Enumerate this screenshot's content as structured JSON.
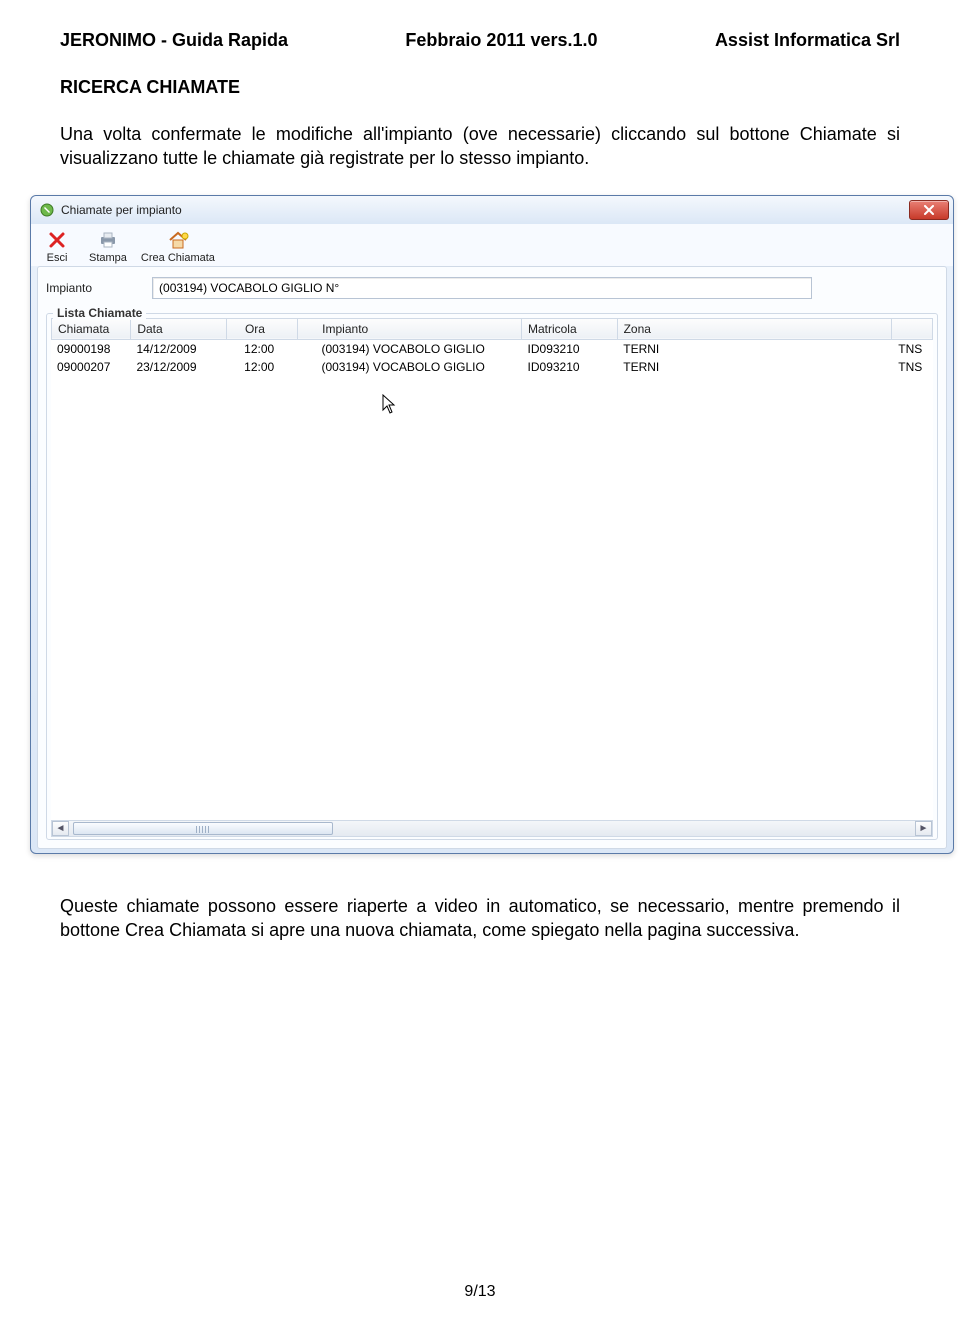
{
  "header": {
    "left": "JERONIMO - Guida Rapida",
    "center": "Febbraio 2011 vers.1.0",
    "right": "Assist Informatica Srl"
  },
  "section_title": "RICERCA CHIAMATE",
  "intro_para": "Una volta confermate le modifiche all'impianto (ove necessarie) cliccando sul bottone Chiamate si visualizzano tutte le chiamate già registrate per lo stesso impianto.",
  "window": {
    "title": "Chiamate per impianto",
    "toolbar": {
      "esci": "Esci",
      "stampa": "Stampa",
      "crea": "Crea Chiamata"
    },
    "field": {
      "label": "Impianto",
      "value": "(003194) VOCABOLO GIGLIO N°"
    },
    "fieldset_legend": "Lista Chiamate",
    "columns": {
      "chiamata": "Chiamata",
      "data": "Data",
      "ora": "Ora",
      "impianto": "Impianto",
      "matricola": "Matricola",
      "zona": "Zona"
    },
    "rows": [
      {
        "chiamata": "09000198",
        "data": "14/12/2009",
        "ora": "12:00",
        "impianto": "(003194) VOCABOLO GIGLIO",
        "matricola": "ID093210",
        "zona": "TERNI",
        "last": "TNS"
      },
      {
        "chiamata": "09000207",
        "data": "23/12/2009",
        "ora": "12:00",
        "impianto": "(003194) VOCABOLO GIGLIO",
        "matricola": "ID093210",
        "zona": "TERNI",
        "last": "TNS"
      }
    ]
  },
  "footer_para": "Queste chiamate possono essere riaperte a video in automatico, se necessario, mentre premendo il bottone Crea Chiamata si apre una nuova chiamata, come spiegato nella pagina successiva.",
  "page_num": "9/13"
}
